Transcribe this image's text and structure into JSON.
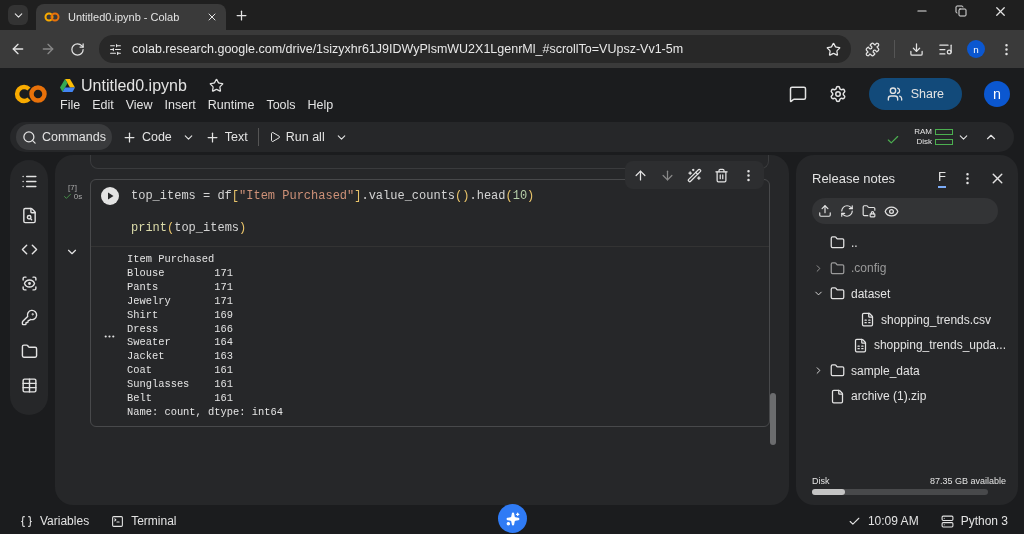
{
  "browser": {
    "tab_title": "Untitled0.ipynb - Colab",
    "url": "colab.research.google.com/drive/1sizyxhr61J9IDWyPlsmWU2X1LgenrMl_#scrollTo=VUpsz-Vv1-5m",
    "profile": "n"
  },
  "notebook": {
    "title": "Untitled0.ipynb",
    "menu": [
      "File",
      "Edit",
      "View",
      "Insert",
      "Runtime",
      "Tools",
      "Help"
    ],
    "share": "Share",
    "avatar": "n"
  },
  "toolbar": {
    "items": [
      {
        "kind": "search",
        "label": "Commands"
      },
      {
        "kind": "add",
        "label": "Code"
      },
      {
        "kind": "add",
        "label": "Text"
      },
      {
        "kind": "run",
        "label": "Run all"
      }
    ],
    "ram": "RAM",
    "disk": "Disk"
  },
  "cell": {
    "count": "[7]",
    "time": "0s",
    "code": [
      [
        {
          "kind": "plain",
          "text": "top_items = df"
        },
        {
          "kind": "bracket",
          "text": "["
        },
        {
          "kind": "string",
          "text": "\"Item Purchased\""
        },
        {
          "kind": "bracket",
          "text": "]"
        },
        {
          "kind": "plain",
          "text": ".value_counts"
        },
        {
          "kind": "bracket",
          "text": "()"
        },
        {
          "kind": "plain",
          "text": ".head"
        },
        {
          "kind": "bracket",
          "text": "("
        },
        {
          "kind": "number",
          "text": "10"
        },
        {
          "kind": "bracket",
          "text": ")"
        }
      ],
      [
        {
          "kind": "func",
          "text": "print"
        },
        {
          "kind": "bracket",
          "text": "("
        },
        {
          "kind": "plain",
          "text": "top_items"
        },
        {
          "kind": "bracket",
          "text": ")"
        }
      ]
    ],
    "output": [
      "Item Purchased",
      "Blouse        171",
      "Pants         171",
      "Jewelry       171",
      "Shirt         169",
      "Dress         166",
      "Sweater       164",
      "Jacket        163",
      "Coat          161",
      "Sunglasses    161",
      "Belt          161",
      "Name: count, dtype: int64"
    ]
  },
  "files": {
    "title": "Release notes",
    "tab": {
      "label": "F",
      "selected": true
    },
    "tree": [
      {
        "kind": "folder",
        "name": "..",
        "muted": false
      },
      {
        "kind": "folder",
        "name": ".config",
        "muted": true,
        "expanded": false
      },
      {
        "kind": "folder",
        "name": "dataset",
        "muted": false,
        "expanded": true,
        "children": [
          {
            "kind": "csv",
            "name": "shopping_trends.csv",
            "muted": false
          },
          {
            "kind": "csv",
            "name": "shopping_trends_upda...",
            "muted": false
          }
        ]
      },
      {
        "kind": "folder",
        "name": "sample_data",
        "muted": false,
        "expanded": false
      },
      {
        "kind": "file",
        "name": "archive (1).zip",
        "muted": false
      }
    ],
    "disk": {
      "label": "Disk",
      "available": "87.35 GB available",
      "level": 0.19
    }
  },
  "status_bar": {
    "variables": "Variables",
    "terminal": "Terminal",
    "time": "10:09 AM",
    "runtime": "Python 3"
  }
}
